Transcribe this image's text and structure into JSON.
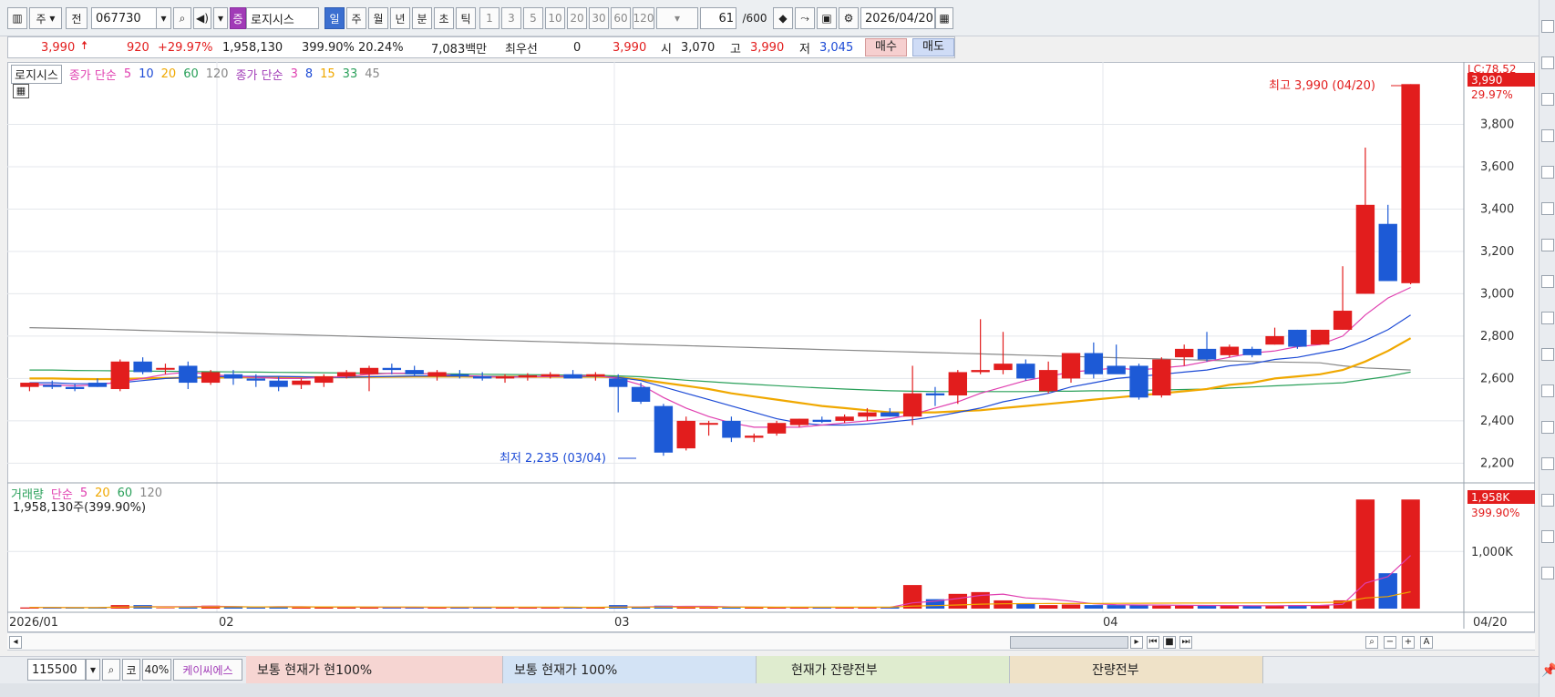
{
  "toolbar": {
    "type_ju": "주",
    "jeon": "전",
    "code": "067730",
    "stock_badge": "증",
    "stock_name": "로지시스",
    "periods": [
      "일",
      "주",
      "월",
      "년",
      "분",
      "초",
      "틱"
    ],
    "intervals": [
      "1",
      "3",
      "5",
      "10",
      "20",
      "30",
      "60",
      "120"
    ],
    "count_value": "61",
    "count_total": "/600",
    "date": "2026/04/20"
  },
  "quote": {
    "price": "3,990",
    "change": "920",
    "change_pct": "+29.97%",
    "volume": "1,958,130",
    "vol_ratio": "399.90%",
    "turnover": "20.24%",
    "amount": "7,083백만",
    "best_label": "최우선",
    "best_qty": "0",
    "best_price": "3,990",
    "open_label": "시",
    "open": "3,070",
    "high_label": "고",
    "high": "3,990",
    "low_label": "저",
    "low": "3,045",
    "buy": "매수",
    "sell": "매도"
  },
  "legend": {
    "stock": "로지시스",
    "ma_label": "종가 단순",
    "ma_periods": [
      "5",
      "10",
      "20",
      "60",
      "120"
    ],
    "ma2_label": "종가 단순",
    "ma2_periods": [
      "3",
      "8",
      "15",
      "33",
      "45"
    ]
  },
  "price_axis": {
    "lc": "LC:78.52",
    "current": "3,990",
    "current_pct": "29.97%",
    "ticks": [
      "3,800",
      "3,600",
      "3,400",
      "3,200",
      "3,000",
      "2,800",
      "2,600",
      "2,400",
      "2,200"
    ]
  },
  "annotations": {
    "high": "최고 3,990 (04/20)",
    "low": "최저 2,235 (03/04)"
  },
  "volume_panel": {
    "title": "거래량",
    "ma_label": "단순",
    "ma_periods": [
      "5",
      "20",
      "60",
      "120"
    ],
    "current_text": "1,958,130주(399.90%)",
    "axis_current": "1,958K",
    "axis_pct": "399.90%",
    "axis_tick": "1,000K"
  },
  "date_axis": {
    "labels": [
      "2026/01",
      "02",
      "03",
      "04",
      "04/20"
    ]
  },
  "bottom": {
    "code": "115500",
    "market": "코",
    "ratio": "40%",
    "name": "케이씨에스",
    "tab1": "보통 현재가 현100%",
    "tab2": "보통 현재가 100%",
    "tab3": "현재가 잔량전부",
    "tab4": "잔량전부"
  },
  "colors": {
    "up": "#e21d1d",
    "down": "#1d5ad6",
    "ma5": "#e040b0",
    "ma10": "#1d4bd6",
    "ma20": "#f0a800",
    "ma60": "#2aa05a",
    "ma120": "#888888"
  },
  "chart_data": {
    "type": "candlestick",
    "ylim": [
      2150,
      4000
    ],
    "candles": [
      {
        "o": 2560,
        "h": 2580,
        "l": 2540,
        "c": 2580
      },
      {
        "o": 2570,
        "h": 2590,
        "l": 2550,
        "c": 2560
      },
      {
        "o": 2560,
        "h": 2575,
        "l": 2540,
        "c": 2550
      },
      {
        "o": 2580,
        "h": 2600,
        "l": 2560,
        "c": 2560
      },
      {
        "o": 2550,
        "h": 2690,
        "l": 2540,
        "c": 2680
      },
      {
        "o": 2680,
        "h": 2700,
        "l": 2620,
        "c": 2630
      },
      {
        "o": 2650,
        "h": 2670,
        "l": 2620,
        "c": 2650
      },
      {
        "o": 2660,
        "h": 2680,
        "l": 2550,
        "c": 2580
      },
      {
        "o": 2580,
        "h": 2640,
        "l": 2570,
        "c": 2630
      },
      {
        "o": 2620,
        "h": 2640,
        "l": 2570,
        "c": 2600
      },
      {
        "o": 2600,
        "h": 2620,
        "l": 2560,
        "c": 2590
      },
      {
        "o": 2590,
        "h": 2610,
        "l": 2540,
        "c": 2560
      },
      {
        "o": 2570,
        "h": 2600,
        "l": 2550,
        "c": 2590
      },
      {
        "o": 2580,
        "h": 2620,
        "l": 2560,
        "c": 2610
      },
      {
        "o": 2610,
        "h": 2640,
        "l": 2600,
        "c": 2630
      },
      {
        "o": 2620,
        "h": 2660,
        "l": 2540,
        "c": 2650
      },
      {
        "o": 2650,
        "h": 2670,
        "l": 2620,
        "c": 2640
      },
      {
        "o": 2640,
        "h": 2660,
        "l": 2610,
        "c": 2620
      },
      {
        "o": 2610,
        "h": 2640,
        "l": 2590,
        "c": 2630
      },
      {
        "o": 2620,
        "h": 2640,
        "l": 2600,
        "c": 2610
      },
      {
        "o": 2610,
        "h": 2630,
        "l": 2590,
        "c": 2600
      },
      {
        "o": 2600,
        "h": 2620,
        "l": 2580,
        "c": 2610
      },
      {
        "o": 2605,
        "h": 2625,
        "l": 2590,
        "c": 2615
      },
      {
        "o": 2610,
        "h": 2630,
        "l": 2600,
        "c": 2620
      },
      {
        "o": 2620,
        "h": 2640,
        "l": 2600,
        "c": 2600
      },
      {
        "o": 2610,
        "h": 2630,
        "l": 2590,
        "c": 2620
      },
      {
        "o": 2600,
        "h": 2620,
        "l": 2440,
        "c": 2560
      },
      {
        "o": 2560,
        "h": 2580,
        "l": 2480,
        "c": 2490
      },
      {
        "o": 2470,
        "h": 2480,
        "l": 2235,
        "c": 2250
      },
      {
        "o": 2270,
        "h": 2420,
        "l": 2260,
        "c": 2400
      },
      {
        "o": 2390,
        "h": 2400,
        "l": 2330,
        "c": 2390
      },
      {
        "o": 2400,
        "h": 2420,
        "l": 2300,
        "c": 2320
      },
      {
        "o": 2320,
        "h": 2340,
        "l": 2300,
        "c": 2330
      },
      {
        "o": 2340,
        "h": 2400,
        "l": 2330,
        "c": 2390
      },
      {
        "o": 2380,
        "h": 2410,
        "l": 2370,
        "c": 2410
      },
      {
        "o": 2405,
        "h": 2420,
        "l": 2390,
        "c": 2395
      },
      {
        "o": 2400,
        "h": 2430,
        "l": 2390,
        "c": 2420
      },
      {
        "o": 2420,
        "h": 2460,
        "l": 2400,
        "c": 2440
      },
      {
        "o": 2440,
        "h": 2460,
        "l": 2420,
        "c": 2420
      },
      {
        "o": 2420,
        "h": 2660,
        "l": 2380,
        "c": 2530
      },
      {
        "o": 2530,
        "h": 2560,
        "l": 2470,
        "c": 2520
      },
      {
        "o": 2520,
        "h": 2640,
        "l": 2480,
        "c": 2630
      },
      {
        "o": 2630,
        "h": 2880,
        "l": 2620,
        "c": 2640
      },
      {
        "o": 2640,
        "h": 2820,
        "l": 2620,
        "c": 2670
      },
      {
        "o": 2670,
        "h": 2690,
        "l": 2590,
        "c": 2600
      },
      {
        "o": 2540,
        "h": 2680,
        "l": 2530,
        "c": 2640
      },
      {
        "o": 2600,
        "h": 2720,
        "l": 2580,
        "c": 2720
      },
      {
        "o": 2720,
        "h": 2770,
        "l": 2600,
        "c": 2620
      },
      {
        "o": 2660,
        "h": 2760,
        "l": 2640,
        "c": 2620
      },
      {
        "o": 2660,
        "h": 2670,
        "l": 2500,
        "c": 2510
      },
      {
        "o": 2520,
        "h": 2700,
        "l": 2510,
        "c": 2690
      },
      {
        "o": 2700,
        "h": 2760,
        "l": 2660,
        "c": 2740
      },
      {
        "o": 2740,
        "h": 2820,
        "l": 2680,
        "c": 2690
      },
      {
        "o": 2710,
        "h": 2760,
        "l": 2700,
        "c": 2750
      },
      {
        "o": 2740,
        "h": 2750,
        "l": 2700,
        "c": 2710
      },
      {
        "o": 2760,
        "h": 2840,
        "l": 2760,
        "c": 2800
      },
      {
        "o": 2830,
        "h": 2830,
        "l": 2740,
        "c": 2750
      },
      {
        "o": 2760,
        "h": 2830,
        "l": 2760,
        "c": 2830
      },
      {
        "o": 2830,
        "h": 3130,
        "l": 2830,
        "c": 2920
      },
      {
        "o": 3000,
        "h": 3690,
        "l": 3000,
        "c": 3420
      },
      {
        "o": 3330,
        "h": 3420,
        "l": 3060,
        "c": 3060
      },
      {
        "o": 3050,
        "h": 3990,
        "l": 3045,
        "c": 3990
      }
    ],
    "volumes": [
      2,
      2,
      1,
      2,
      6,
      6,
      1,
      2,
      5,
      4,
      2,
      3,
      2,
      3,
      2,
      2,
      2,
      2,
      2,
      2,
      2,
      2,
      2,
      2,
      2,
      2,
      6,
      3,
      5,
      3,
      2,
      2,
      2,
      2,
      2,
      2,
      2,
      2,
      3,
      40,
      16,
      25,
      28,
      14,
      8,
      6,
      7,
      6,
      6,
      6,
      5,
      5,
      5,
      5,
      5,
      5,
      6,
      6,
      14,
      185,
      60,
      185
    ],
    "ma": {
      "ma5": [
        2570,
        2570,
        2565,
        2570,
        2585,
        2600,
        2620,
        2630,
        2620,
        2610,
        2605,
        2600,
        2600,
        2605,
        2610,
        2620,
        2625,
        2625,
        2620,
        2615,
        2610,
        2605,
        2608,
        2610,
        2612,
        2614,
        2600,
        2570,
        2510,
        2460,
        2420,
        2390,
        2370,
        2370,
        2370,
        2380,
        2390,
        2400,
        2410,
        2430,
        2460,
        2490,
        2530,
        2560,
        2590,
        2610,
        2630,
        2640,
        2650,
        2640,
        2650,
        2660,
        2680,
        2700,
        2720,
        2730,
        2750,
        2760,
        2800,
        2900,
        2980,
        3030
      ],
      "ma10": [
        2580,
        2580,
        2575,
        2575,
        2580,
        2590,
        2600,
        2605,
        2608,
        2610,
        2610,
        2610,
        2608,
        2605,
        2605,
        2608,
        2610,
        2612,
        2612,
        2612,
        2610,
        2608,
        2608,
        2610,
        2610,
        2611,
        2605,
        2590,
        2560,
        2530,
        2500,
        2470,
        2440,
        2410,
        2390,
        2380,
        2380,
        2385,
        2395,
        2405,
        2420,
        2440,
        2460,
        2490,
        2510,
        2530,
        2560,
        2580,
        2600,
        2610,
        2620,
        2630,
        2640,
        2660,
        2670,
        2690,
        2700,
        2720,
        2740,
        2780,
        2830,
        2900
      ],
      "ma20": [
        2600,
        2600,
        2598,
        2597,
        2598,
        2600,
        2602,
        2603,
        2604,
        2605,
        2606,
        2606,
        2606,
        2606,
        2606,
        2607,
        2608,
        2609,
        2609,
        2609,
        2608,
        2608,
        2608,
        2608,
        2608,
        2608,
        2605,
        2595,
        2580,
        2565,
        2550,
        2530,
        2515,
        2500,
        2485,
        2470,
        2460,
        2450,
        2440,
        2440,
        2440,
        2445,
        2450,
        2460,
        2470,
        2480,
        2490,
        2500,
        2510,
        2520,
        2530,
        2540,
        2550,
        2570,
        2580,
        2600,
        2610,
        2620,
        2640,
        2680,
        2730,
        2790
      ],
      "ma60": [
        2640,
        2640,
        2638,
        2637,
        2636,
        2635,
        2634,
        2633,
        2632,
        2631,
        2630,
        2629,
        2628,
        2627,
        2626,
        2625,
        2624,
        2623,
        2622,
        2621,
        2620,
        2619,
        2618,
        2617,
        2616,
        2615,
        2612,
        2608,
        2600,
        2592,
        2585,
        2578,
        2572,
        2566,
        2560,
        2555,
        2550,
        2546,
        2542,
        2540,
        2538,
        2538,
        2538,
        2538,
        2538,
        2540,
        2540,
        2542,
        2542,
        2544,
        2546,
        2548,
        2550,
        2555,
        2560,
        2565,
        2570,
        2575,
        2580,
        2595,
        2610,
        2630
      ],
      "ma120": [
        2840,
        2838,
        2836,
        2833,
        2830,
        2827,
        2824,
        2821,
        2818,
        2815,
        2812,
        2809,
        2806,
        2803,
        2800,
        2797,
        2794,
        2791,
        2788,
        2785,
        2782,
        2779,
        2776,
        2773,
        2770,
        2767,
        2764,
        2761,
        2758,
        2755,
        2752,
        2749,
        2746,
        2743,
        2740,
        2737,
        2734,
        2731,
        2728,
        2725,
        2722,
        2719,
        2716,
        2713,
        2710,
        2707,
        2704,
        2701,
        2698,
        2695,
        2692,
        2689,
        2686,
        2683,
        2680,
        2678,
        2676,
        2674,
        2660,
        2650,
        2645,
        2640
      ]
    }
  }
}
